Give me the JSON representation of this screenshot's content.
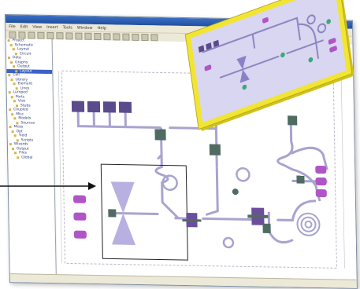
{
  "window": {
    "title": "",
    "menus": [
      "File",
      "Edit",
      "View",
      "Insert",
      "Tools",
      "Window",
      "Help"
    ]
  },
  "sidebar": {
    "items": [
      {
        "label": "Project",
        "selected": false
      },
      {
        "label": "Schematic",
        "selected": false
      },
      {
        "label": "Layout",
        "selected": false
      },
      {
        "label": "Circuit",
        "selected": false
      },
      {
        "label": "Data",
        "selected": false
      },
      {
        "label": "Graphs",
        "selected": false
      },
      {
        "label": "Output",
        "selected": false
      },
      {
        "label": "Layout",
        "selected": true
      },
      {
        "label": "Cell",
        "selected": false
      },
      {
        "label": "Library",
        "selected": false
      },
      {
        "label": "Element",
        "selected": false
      },
      {
        "label": "Lines",
        "selected": false
      },
      {
        "label": "Lumped",
        "selected": false
      },
      {
        "label": "Ports",
        "selected": false
      },
      {
        "label": "Vias",
        "selected": false
      },
      {
        "label": "Stubs",
        "selected": false
      },
      {
        "label": "Coupled",
        "selected": false
      },
      {
        "label": "Misc",
        "selected": false
      },
      {
        "label": "Models",
        "selected": false
      },
      {
        "label": "Sources",
        "selected": false
      },
      {
        "label": "Meas",
        "selected": false
      },
      {
        "label": "Opt",
        "selected": false
      },
      {
        "label": "Yield",
        "selected": false
      },
      {
        "label": "Scripts",
        "selected": false
      },
      {
        "label": "Wizards",
        "selected": false
      },
      {
        "label": "Output",
        "selected": false
      },
      {
        "label": "Files",
        "selected": false
      },
      {
        "label": "Global",
        "selected": false
      }
    ]
  },
  "status": {
    "text": ""
  },
  "colors": {
    "pad_dark": "#5b4a8c",
    "pad_green": "#4f6b62",
    "pad_magenta": "#b055c8",
    "trace": "#a8a3cf",
    "pcb_frame": "#f2e532",
    "pcb_board": "#d8d6f0"
  }
}
